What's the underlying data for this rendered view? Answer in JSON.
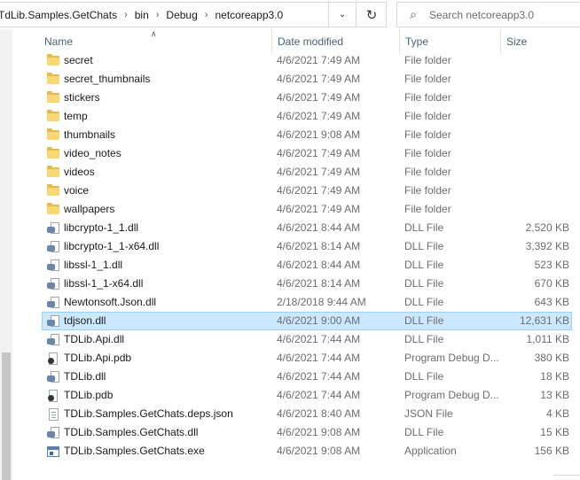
{
  "address": {
    "breadcrumbs": [
      "TdLib.Samples.GetChats",
      "bin",
      "Debug",
      "netcoreapp3.0"
    ],
    "dropdown_icon": "chevron-down-icon",
    "refresh_icon": "refresh-icon"
  },
  "search": {
    "placeholder": "Search netcoreapp3.0",
    "icon": "search-icon"
  },
  "columns": {
    "name": "Name",
    "date": "Date modified",
    "type": "Type",
    "size": "Size"
  },
  "files": [
    {
      "icon": "folder-icon",
      "name": "secret",
      "date": "4/6/2021 7:49 AM",
      "type": "File folder",
      "size": ""
    },
    {
      "icon": "folder-icon",
      "name": "secret_thumbnails",
      "date": "4/6/2021 7:49 AM",
      "type": "File folder",
      "size": ""
    },
    {
      "icon": "folder-icon",
      "name": "stickers",
      "date": "4/6/2021 7:49 AM",
      "type": "File folder",
      "size": ""
    },
    {
      "icon": "folder-icon",
      "name": "temp",
      "date": "4/6/2021 7:49 AM",
      "type": "File folder",
      "size": ""
    },
    {
      "icon": "folder-icon",
      "name": "thumbnails",
      "date": "4/6/2021 9:08 AM",
      "type": "File folder",
      "size": ""
    },
    {
      "icon": "folder-icon",
      "name": "video_notes",
      "date": "4/6/2021 7:49 AM",
      "type": "File folder",
      "size": ""
    },
    {
      "icon": "folder-icon",
      "name": "videos",
      "date": "4/6/2021 7:49 AM",
      "type": "File folder",
      "size": ""
    },
    {
      "icon": "folder-icon",
      "name": "voice",
      "date": "4/6/2021 7:49 AM",
      "type": "File folder",
      "size": ""
    },
    {
      "icon": "folder-icon",
      "name": "wallpapers",
      "date": "4/6/2021 7:49 AM",
      "type": "File folder",
      "size": ""
    },
    {
      "icon": "dll-icon",
      "name": "libcrypto-1_1.dll",
      "date": "4/6/2021 8:44 AM",
      "type": "DLL File",
      "size": "2,520 KB"
    },
    {
      "icon": "dll-icon",
      "name": "libcrypto-1_1-x64.dll",
      "date": "4/6/2021 8:14 AM",
      "type": "DLL File",
      "size": "3,392 KB"
    },
    {
      "icon": "dll-icon",
      "name": "libssl-1_1.dll",
      "date": "4/6/2021 8:44 AM",
      "type": "DLL File",
      "size": "523 KB"
    },
    {
      "icon": "dll-icon",
      "name": "libssl-1_1-x64.dll",
      "date": "4/6/2021 8:14 AM",
      "type": "DLL File",
      "size": "670 KB"
    },
    {
      "icon": "dll-icon",
      "name": "Newtonsoft.Json.dll",
      "date": "2/18/2018 9:44 AM",
      "type": "DLL File",
      "size": "643 KB"
    },
    {
      "icon": "dll-icon",
      "name": "tdjson.dll",
      "date": "4/6/2021 9:00 AM",
      "type": "DLL File",
      "size": "12,631 KB",
      "selected": true
    },
    {
      "icon": "dll-icon",
      "name": "TDLib.Api.dll",
      "date": "4/6/2021 7:44 AM",
      "type": "DLL File",
      "size": "1,011 KB"
    },
    {
      "icon": "pdb-icon",
      "name": "TDLib.Api.pdb",
      "date": "4/6/2021 7:44 AM",
      "type": "Program Debug D...",
      "size": "380 KB"
    },
    {
      "icon": "dll-icon",
      "name": "TDLib.dll",
      "date": "4/6/2021 7:44 AM",
      "type": "DLL File",
      "size": "18 KB"
    },
    {
      "icon": "pdb-icon",
      "name": "TDLib.pdb",
      "date": "4/6/2021 7:44 AM",
      "type": "Program Debug D...",
      "size": "13 KB"
    },
    {
      "icon": "json-file-icon",
      "name": "TDLib.Samples.GetChats.deps.json",
      "date": "4/6/2021 8:40 AM",
      "type": "JSON File",
      "size": "4 KB"
    },
    {
      "icon": "dll-icon",
      "name": "TDLib.Samples.GetChats.dll",
      "date": "4/6/2021 9:08 AM",
      "type": "DLL File",
      "size": "15 KB"
    },
    {
      "icon": "exe-icon",
      "name": "TDLib.Samples.GetChats.exe",
      "date": "4/6/2021 9:08 AM",
      "type": "Application",
      "size": "156 KB"
    }
  ],
  "colors": {
    "selection_bg": "#cce8ff",
    "selection_border": "#99d1ff",
    "header_text": "#4c607a",
    "folder": "#f8d775"
  }
}
